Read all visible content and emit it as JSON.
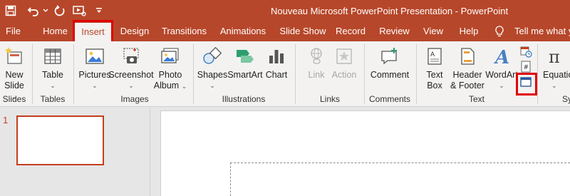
{
  "window": {
    "title": "Nouveau Microsoft PowerPoint Presentation  -  PowerPoint"
  },
  "qat": [
    "save-icon",
    "undo-icon",
    "redo-icon",
    "present-icon",
    "customize-icon"
  ],
  "tabs": [
    "File",
    "Home",
    "Insert",
    "Design",
    "Transitions",
    "Animations",
    "Slide Show",
    "Record",
    "Review",
    "View",
    "Help"
  ],
  "active_tab": "Insert",
  "tell_me": "Tell me what you",
  "ribbon": {
    "new_slide": [
      "New",
      "Slide"
    ],
    "table": "Table",
    "pictures": "Pictures",
    "screenshot": "Screenshot",
    "photo_album": [
      "Photo",
      "Album"
    ],
    "shapes": "Shapes",
    "smartart": "SmartArt",
    "chart": "Chart",
    "link": "Link",
    "action": "Action",
    "comment": "Comment",
    "text_box": [
      "Text",
      "Box"
    ],
    "header_footer": [
      "Header",
      "& Footer"
    ],
    "wordart": "WordArt",
    "equation": "Equatio",
    "caret": "⌄",
    "groups": [
      "Slides",
      "Tables",
      "Images",
      "Illustrations",
      "Links",
      "Comments",
      "Text",
      "Sy"
    ]
  },
  "slides": {
    "number": "1"
  },
  "colors": {
    "accent": "#b7472a",
    "highlight": "#e00000",
    "ribbon_bg": "#f3f2f1"
  }
}
